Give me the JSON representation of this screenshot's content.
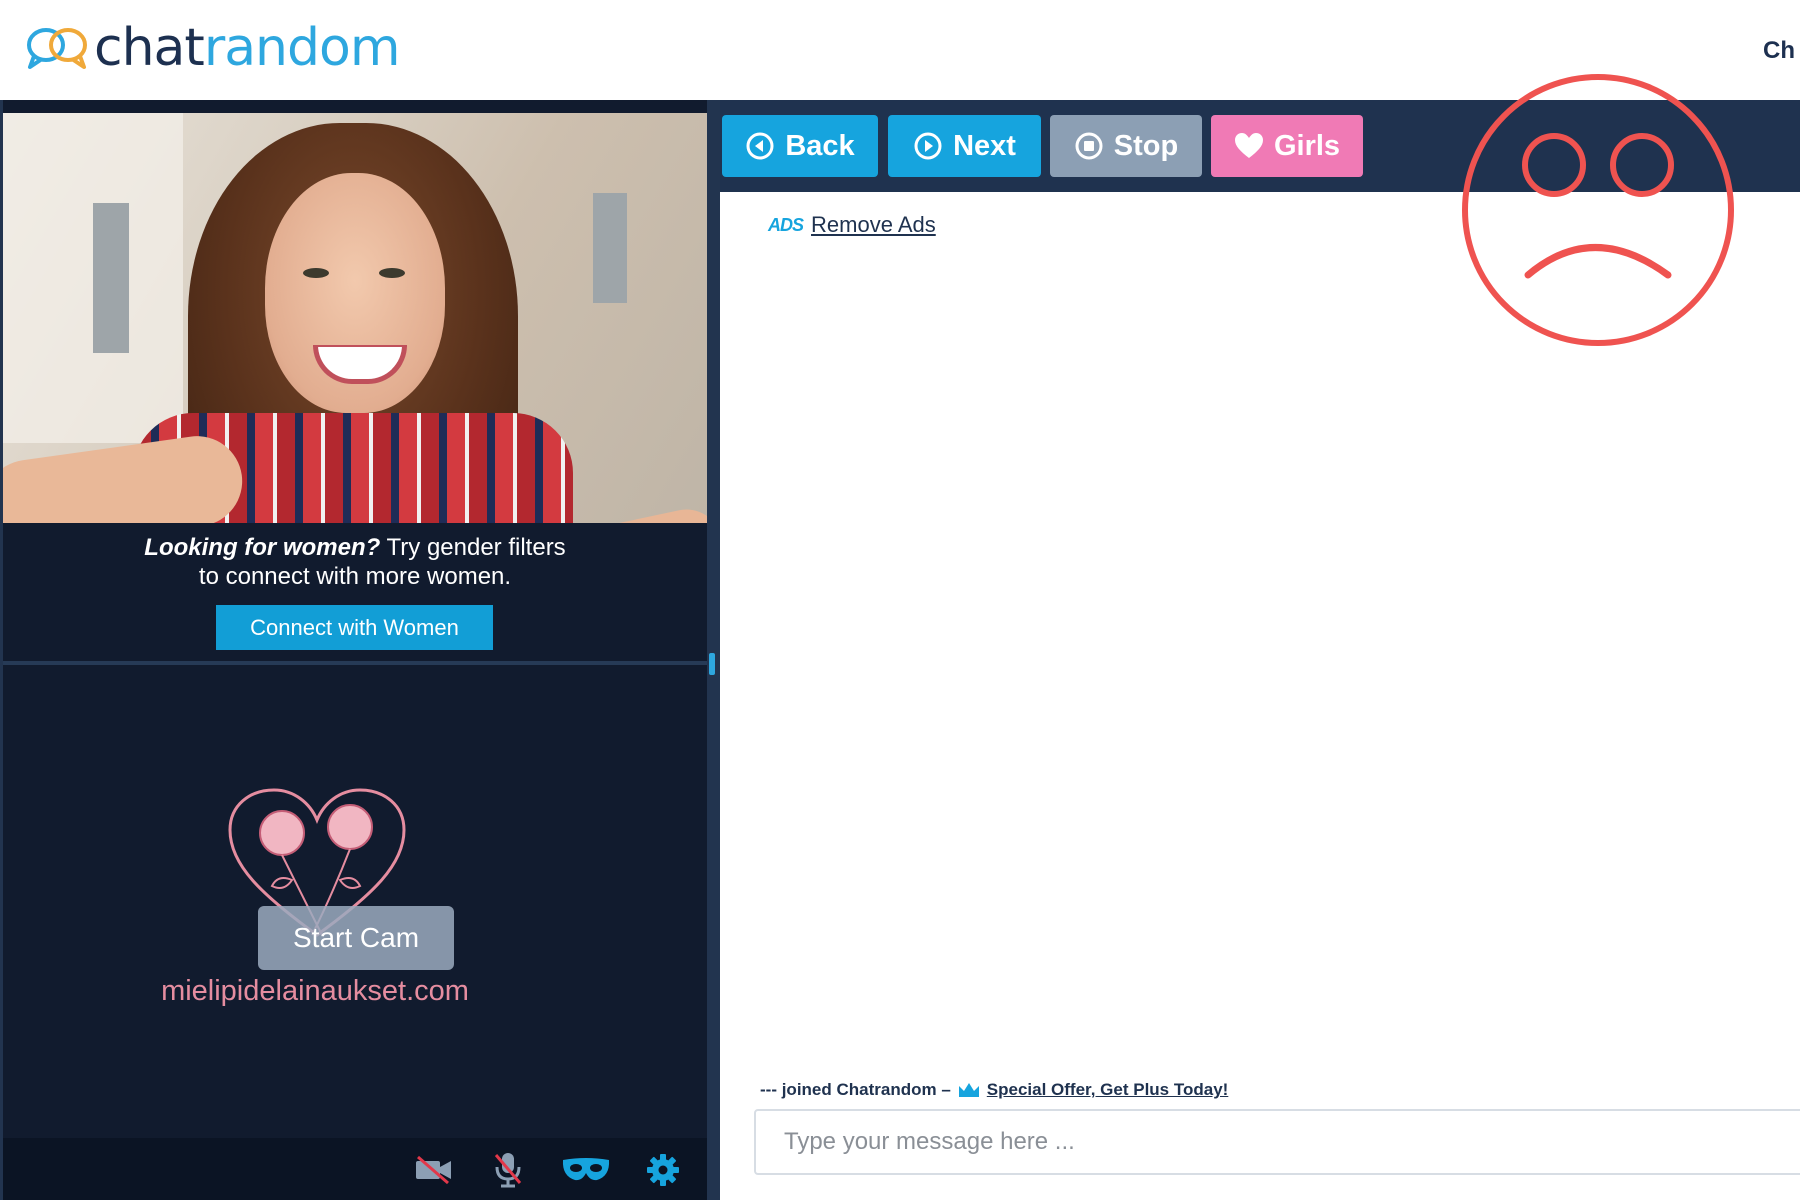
{
  "header": {
    "logo_part1": "chat",
    "logo_part2": "random",
    "right_text": "Ch"
  },
  "promo": {
    "headline_italic": "Looking for women?",
    "headline_rest": " Try gender filters",
    "line2": "to connect with more women.",
    "button_label": "Connect with Women"
  },
  "camera": {
    "start_label": "Start Cam",
    "watermark": "mielipidelainaukset.com"
  },
  "toolbar_icons": [
    "video-off-icon",
    "mic-off-icon",
    "mask-icon",
    "gear-icon"
  ],
  "nav": {
    "back": "Back",
    "next": "Next",
    "stop": "Stop",
    "girls": "Girls"
  },
  "chat": {
    "ads_icon": "ADS",
    "remove_ads": "Remove Ads",
    "status_text": "--- joined Chatrandom –",
    "offer_link": "Special Offer, Get Plus Today!",
    "message_placeholder": "Type your message here ..."
  },
  "colors": {
    "brand_blue": "#16a4de",
    "navy": "#1f324f",
    "dark_panel": "#111b2e",
    "stop_gray": "#8c9fb4",
    "girls_pink": "#f07ab5",
    "sad_face_red": "#ef5350"
  }
}
